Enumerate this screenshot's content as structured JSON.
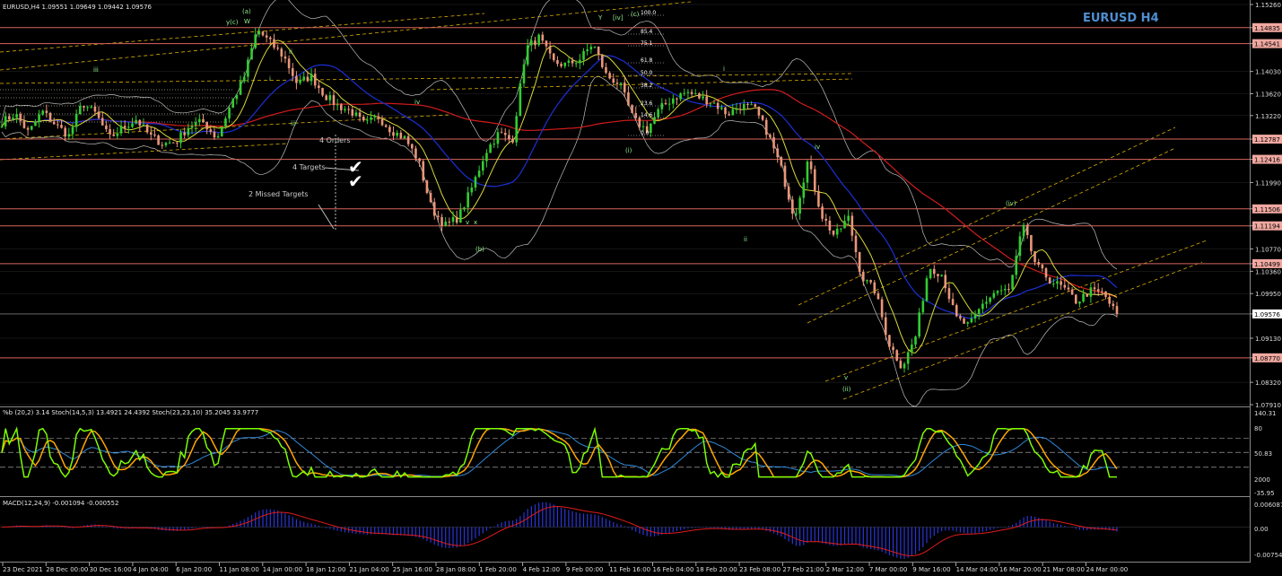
{
  "header": {
    "info": "EURUSD,H4  1.09551 1.09649 1.09442 1.09576",
    "symbol_title": "EURUSD H4"
  },
  "colors": {
    "background": "#000000",
    "grid": "#2a2a2a",
    "bull": "#32cd32",
    "bear": "#e9967a",
    "level": "#d8645c",
    "ema_blue": "#1c2fd6",
    "ema_red": "#d21c1c",
    "ema_yellow": "#d9d93a",
    "bands": "#bfbfbf",
    "channel": "#ffcc00",
    "title": "#4f8fd1",
    "stoch_main": "#7cfc00",
    "stoch_signal": "#ffa500",
    "macd_hist": "#2a36d8",
    "macd_signal": "#e01b1b"
  },
  "chart_data": [
    {
      "type": "candlestick",
      "title": "EURUSD H4",
      "ylim": [
        1.0791,
        1.1526
      ],
      "y_ticks": [
        "1.15260",
        "1.14835",
        "1.14541",
        "1.14030",
        "1.13620",
        "1.13220",
        "1.12787",
        "1.12416",
        "1.11990",
        "1.11506",
        "1.11194",
        "1.10770",
        "1.10499",
        "1.10360",
        "1.09950",
        "1.09576",
        "1.09130",
        "1.08770",
        "1.08320",
        "1.07910"
      ],
      "price_levels": [
        {
          "label": "1.14835",
          "value": 1.14835
        },
        {
          "label": "1.14541",
          "value": 1.14541
        },
        {
          "label": "1.12787",
          "value": 1.12787
        },
        {
          "label": "1.12416",
          "value": 1.12416
        },
        {
          "label": "1.11506",
          "value": 1.11506
        },
        {
          "label": "1.11194",
          "value": 1.11194
        },
        {
          "label": "1.10499",
          "value": 1.10499
        },
        {
          "label": "1.08770",
          "value": 1.0877
        }
      ],
      "current_price": {
        "label": "1.09576",
        "value": 1.09576
      },
      "x_tick_labels": [
        "23 Dec 2021",
        "28 Dec 00:00",
        "30 Dec 16:00",
        "4 Jan 04:00",
        "6 Jan 20:00",
        "11 Jan 08:00",
        "14 Jan 00:00",
        "18 Jan 12:00",
        "21 Jan 04:00",
        "25 Jan 16:00",
        "28 Jan 08:00",
        "1 Feb 20:00",
        "4 Feb 12:00",
        "9 Feb 00:00",
        "11 Feb 16:00",
        "16 Feb 04:00",
        "18 Feb 20:00",
        "23 Feb 08:00",
        "27 Feb 21:00",
        "2 Mar 12:00",
        "7 Mar 00:00",
        "9 Mar 16:00",
        "14 Mar 04:00",
        "16 Mar 20:00",
        "21 Mar 08:00",
        "24 Mar 00:00"
      ],
      "price_path": [
        1.131,
        1.1325,
        1.129,
        1.133,
        1.1305,
        1.1285,
        1.1345,
        1.1325,
        1.128,
        1.13,
        1.1315,
        1.1285,
        1.127,
        1.1275,
        1.1305,
        1.131,
        1.128,
        1.134,
        1.139,
        1.148,
        1.1455,
        1.143,
        1.138,
        1.1395,
        1.136,
        1.134,
        1.133,
        1.1305,
        1.132,
        1.1295,
        1.128,
        1.124,
        1.115,
        1.112,
        1.1135,
        1.119,
        1.1255,
        1.129,
        1.1275,
        1.1445,
        1.1465,
        1.142,
        1.1415,
        1.1425,
        1.1455,
        1.1395,
        1.138,
        1.1315,
        1.1295,
        1.1335,
        1.1355,
        1.1365,
        1.1355,
        1.1345,
        1.1325,
        1.134,
        1.1335,
        1.129,
        1.1225,
        1.1135,
        1.124,
        1.114,
        1.11,
        1.1135,
        1.1025,
        1.1,
        1.0905,
        1.086,
        1.0915,
        1.1045,
        1.103,
        1.095,
        1.0935,
        1.0975,
        1.1,
        1.1,
        1.112,
        1.1045,
        1.102,
        1.1005,
        1.098,
        1.1,
        1.0995,
        1.0955
      ],
      "annotations": [
        "(a)",
        "W",
        "y(c)",
        "iii",
        "ii",
        "i",
        "iii",
        "iv",
        "v",
        "x",
        "(b)",
        "(c)",
        "Y",
        "[iv]",
        "(i)",
        "i",
        "ii",
        "iv",
        "v",
        "(ii)",
        "(iv)",
        "4 Orders",
        "4 Targets",
        "2 Missed Targets"
      ],
      "fib_levels": [
        "100.0",
        "85.4",
        "75.1",
        "61.8",
        "50.0",
        "38.2",
        "23.6",
        "14.6",
        "0.0"
      ]
    },
    {
      "type": "line",
      "header": "%b (20,2) 3.14  Stoch(14,5,3) 13.4921 24.4392  Stoch(23,23,10) 35.2045 33.9777",
      "y_tick_labels": [
        "140.31",
        "80",
        "50.83",
        "2000",
        "-35.95"
      ],
      "ylim": [
        -35.95,
        140.31
      ]
    },
    {
      "type": "bar",
      "header": "MACD(12,24,9) -0.001094 -0.000552",
      "y_tick_labels": [
        "0.006087",
        "0.00",
        "-0.007543"
      ],
      "ylim": [
        -0.007543,
        0.006087
      ]
    }
  ]
}
